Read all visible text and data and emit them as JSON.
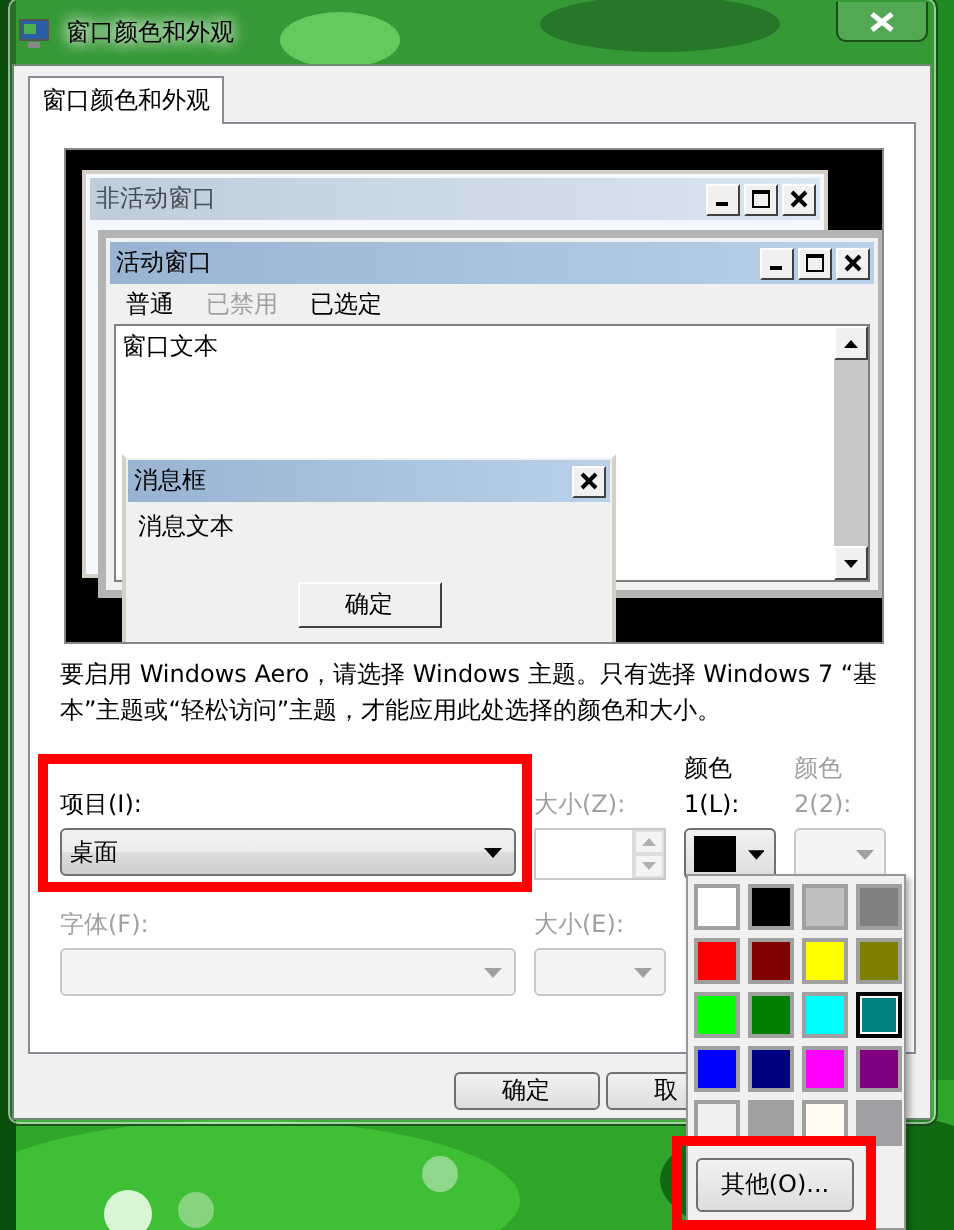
{
  "window": {
    "title": "窗口颜色和外观"
  },
  "tabs": [
    {
      "label": "窗口颜色和外观",
      "selected": true
    }
  ],
  "preview": {
    "inactive_window": {
      "title": "非活动窗口"
    },
    "active_window": {
      "title": "活动窗口",
      "menu": [
        {
          "label": "普通",
          "disabled": false
        },
        {
          "label": "已禁用",
          "disabled": true
        },
        {
          "label": "已选定",
          "disabled": false
        }
      ],
      "text": "窗口文本"
    },
    "message_box": {
      "title": "消息框",
      "text": "消息文本",
      "button": "确定"
    }
  },
  "description": "要启用 Windows Aero，请选择 Windows 主题。只有选择 Windows 7 “基本”主题或“轻松访问”主题，才能应用此处选择的颜色和大小。",
  "item": {
    "label": "项目(I):",
    "value": "桌面",
    "disabled": false
  },
  "item_size": {
    "label": "大小(Z):",
    "disabled": true
  },
  "color1": {
    "label": [
      "颜色",
      "1(L):"
    ],
    "disabled": false,
    "color": "#000000"
  },
  "color2": {
    "label": [
      "颜色",
      "2(2):"
    ],
    "disabled": true
  },
  "font": {
    "label": "字体(F):",
    "disabled": true
  },
  "font_size": {
    "label": "大小(E):",
    "disabled": true
  },
  "buttons": [
    {
      "label": "确定"
    },
    {
      "label": "取"
    }
  ],
  "palette": {
    "swatches": [
      {
        "color": "#ffffff",
        "selected": false
      },
      {
        "color": "#000000",
        "selected": false
      },
      {
        "color": "#c0c0c0",
        "selected": false
      },
      {
        "color": "#808080",
        "selected": false
      },
      {
        "color": "#ff0000",
        "selected": false
      },
      {
        "color": "#800000",
        "selected": false
      },
      {
        "color": "#ffff00",
        "selected": false
      },
      {
        "color": "#808000",
        "selected": false
      },
      {
        "color": "#00ff00",
        "selected": false
      },
      {
        "color": "#008000",
        "selected": false
      },
      {
        "color": "#00ffff",
        "selected": false
      },
      {
        "color": "#008080",
        "selected": true
      },
      {
        "color": "#0000ff",
        "selected": false
      },
      {
        "color": "#000080",
        "selected": false
      },
      {
        "color": "#ff00ff",
        "selected": false
      },
      {
        "color": "#800080",
        "selected": false
      },
      {
        "color": "#f0f0f0",
        "selected": false
      },
      {
        "color": "#a0a0a0",
        "selected": false
      },
      {
        "color": "#fffbf0",
        "selected": false
      },
      {
        "color": "#a0a0a4",
        "selected": false
      }
    ],
    "other_button": "其他(O)..."
  }
}
